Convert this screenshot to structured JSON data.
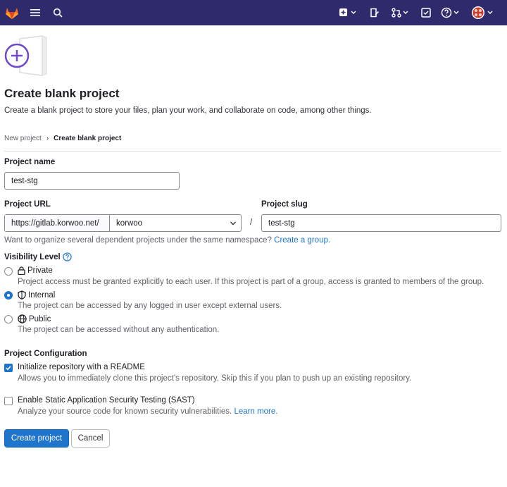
{
  "colors": {
    "topbar": "#2f2a6b",
    "primary": "#1f75cb",
    "text": "#333238",
    "muted": "#626168",
    "link": "#1f75cb"
  },
  "topbar": {
    "logo_icon": "gitlab-tanuki-icon",
    "menu_icon": "hamburger-menu-icon",
    "search_icon": "search-icon",
    "new_icon": "plus-square-icon",
    "issues_icon": "issues-icon",
    "merge_requests_icon": "merge-request-icon",
    "todos_icon": "todo-checkbox-icon",
    "help_icon": "help-icon",
    "avatar_icon": "user-avatar"
  },
  "page": {
    "title": "Create blank project",
    "description": "Create a blank project to store your files, plan your work, and collaborate on code, among other things."
  },
  "breadcrumb": {
    "parent": "New project",
    "separator": "›",
    "current": "Create blank project"
  },
  "form": {
    "project_name": {
      "label": "Project name",
      "value": "test-stg"
    },
    "project_url": {
      "label": "Project URL",
      "prefix": "https://gitlab.korwoo.net/",
      "namespace": "korwoo",
      "separator": "/"
    },
    "project_slug": {
      "label": "Project slug",
      "value": "test-stg"
    },
    "group_hint": {
      "text": "Want to organize several dependent projects under the same namespace?",
      "link": "Create a group."
    },
    "visibility": {
      "label": "Visibility Level",
      "options": [
        {
          "title": "Private",
          "icon": "lock-icon",
          "checked": false,
          "description": "Project access must be granted explicitly to each user. If this project is part of a group, access is granted to members of the group."
        },
        {
          "title": "Internal",
          "icon": "shield-icon",
          "checked": true,
          "description": "The project can be accessed by any logged in user except external users."
        },
        {
          "title": "Public",
          "icon": "globe-icon",
          "checked": false,
          "description": "The project can be accessed without any authentication."
        }
      ]
    },
    "configuration": {
      "label": "Project Configuration",
      "readme": {
        "label": "Initialize repository with a README",
        "checked": true,
        "description": "Allows you to immediately clone this project’s repository. Skip this if you plan to push up an existing repository."
      },
      "sast": {
        "label": "Enable Static Application Security Testing (SAST)",
        "checked": false,
        "description": "Analyze your source code for known security vulnerabilities.",
        "link": "Learn more."
      }
    }
  },
  "buttons": {
    "create": "Create project",
    "cancel": "Cancel"
  }
}
